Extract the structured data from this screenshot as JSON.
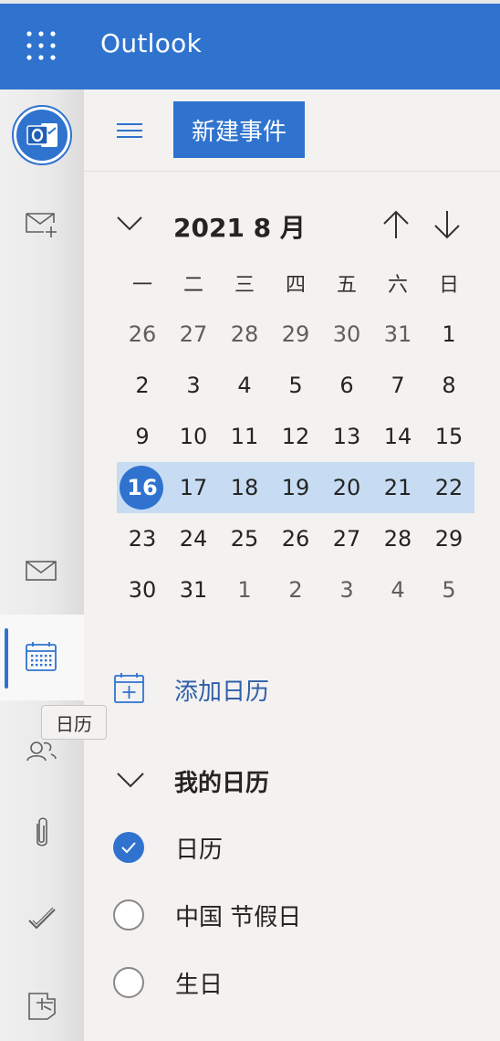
{
  "app": {
    "title": "Outlook"
  },
  "toolbar": {
    "new_event_label": "新建事件"
  },
  "rail": {
    "items": [
      {
        "name": "new-mail",
        "icon": "mail-add-icon"
      },
      {
        "name": "mail",
        "icon": "mail-icon"
      },
      {
        "name": "calendar",
        "icon": "calendar-icon",
        "selected": true
      },
      {
        "name": "people",
        "icon": "people-icon"
      },
      {
        "name": "files",
        "icon": "paperclip-icon"
      },
      {
        "name": "todo",
        "icon": "checkmark-icon"
      },
      {
        "name": "yammer",
        "icon": "teams-app-icon"
      }
    ],
    "tooltip": "日历"
  },
  "minical": {
    "month_label": "2021 8 月",
    "weekdays": [
      "一",
      "二",
      "三",
      "四",
      "五",
      "六",
      "日"
    ],
    "weeks": [
      [
        "26",
        "27",
        "28",
        "29",
        "30",
        "31",
        "1"
      ],
      [
        "2",
        "3",
        "4",
        "5",
        "6",
        "7",
        "8"
      ],
      [
        "9",
        "10",
        "11",
        "12",
        "13",
        "14",
        "15"
      ],
      [
        "16",
        "17",
        "18",
        "19",
        "20",
        "21",
        "22"
      ],
      [
        "23",
        "24",
        "25",
        "26",
        "27",
        "28",
        "29"
      ],
      [
        "30",
        "31",
        "1",
        "2",
        "3",
        "4",
        "5"
      ]
    ],
    "today": "16",
    "selected_week_index": 3
  },
  "sidebar": {
    "add_calendar_label": "添加日历",
    "my_calendars_label": "我的日历",
    "calendars": [
      {
        "label": "日历",
        "checked": true
      },
      {
        "label": "中国 节假日",
        "checked": false
      },
      {
        "label": "生日",
        "checked": false
      }
    ]
  },
  "colors": {
    "accent": "#2f73cf",
    "selected_week": "#c7dcf3",
    "link": "#2f5fa8"
  }
}
